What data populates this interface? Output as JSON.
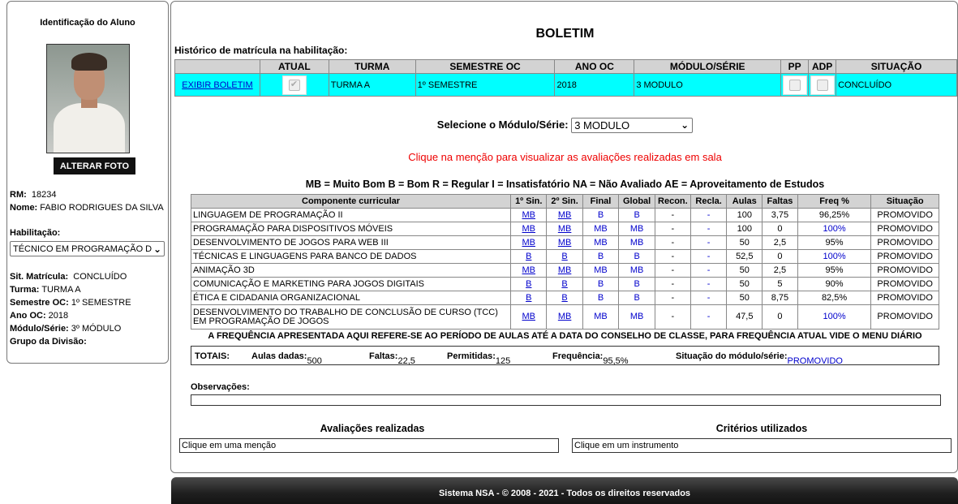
{
  "sidebar": {
    "title": "Identificação do Aluno",
    "photo_button": "ALTERAR FOTO",
    "rm_label": "RM:",
    "rm_value": "18234",
    "nome_label": "Nome:",
    "nome_value": "FABIO RODRIGUES DA SILVA",
    "habilitacao_label": "Habilitação:",
    "habilitacao_value": "TÉCNICO EM PROGRAMAÇÃO D",
    "sit_matricula_label": "Sit. Matrícula:",
    "sit_matricula_value": "CONCLUÍDO",
    "turma_label": "Turma:",
    "turma_value": "TURMA A",
    "semestre_label": "Semestre OC:",
    "semestre_value": "1º SEMESTRE",
    "ano_label": "Ano OC:",
    "ano_value": "2018",
    "modulo_label": "Módulo/Série:",
    "modulo_value": "3º MÓDULO",
    "grupo_label": "Grupo da Divisão:",
    "grupo_value": ""
  },
  "main": {
    "title": "BOLETIM",
    "historico_label": "Histórico de matrícula na habilitação:",
    "historico_headers": [
      "",
      "ATUAL",
      "TURMA",
      "SEMESTRE OC",
      "ANO OC",
      "MÓDULO/SÉRIE",
      "PP",
      "ADP",
      "SITUAÇÃO"
    ],
    "historico_row": {
      "link": "EXIBIR BOLETIM",
      "turma": "TURMA A",
      "semestre": "1º SEMESTRE",
      "ano": "2018",
      "modulo": "3 MODULO",
      "situacao": "CONCLUÍDO"
    },
    "modulo_select_label": "Selecione o Módulo/Série:",
    "modulo_select_value": "3 MODULO",
    "aviso": "Clique na menção para visualizar as avaliações realizadas em sala",
    "legenda": "MB = Muito Bom  B = Bom  R = Regular  I = Insatisfatório  NA = Não Avaliado  AE = Aproveitamento de Estudos",
    "notas_headers": [
      "Componente curricular",
      "1º Sin.",
      "2º Sin.",
      "Final",
      "Global",
      "Recon.",
      "Recla.",
      "Aulas",
      "Faltas",
      "Freq %",
      "Situação"
    ],
    "notas_rows": [
      {
        "comp": "LINGUAGEM DE PROGRAMAÇÃO II",
        "s1": "MB",
        "s2": "MB",
        "final": "B",
        "global": "B",
        "recon": "-",
        "recla": "-",
        "aulas": "100",
        "faltas": "3,75",
        "freq": "96,25%",
        "sit": "PROMOVIDO"
      },
      {
        "comp": "PROGRAMAÇÃO PARA DISPOSITIVOS MÓVEIS",
        "s1": "MB",
        "s2": "MB",
        "final": "MB",
        "global": "MB",
        "recon": "-",
        "recla": "-",
        "aulas": "100",
        "faltas": "0",
        "freq": "100%",
        "sit": "PROMOVIDO"
      },
      {
        "comp": "DESENVOLVIMENTO DE JOGOS PARA WEB III",
        "s1": "MB",
        "s2": "MB",
        "final": "MB",
        "global": "MB",
        "recon": "-",
        "recla": "-",
        "aulas": "50",
        "faltas": "2,5",
        "freq": "95%",
        "sit": "PROMOVIDO"
      },
      {
        "comp": "TÉCNICAS E LINGUAGENS PARA BANCO DE DADOS",
        "s1": "B",
        "s2": "B",
        "final": "B",
        "global": "B",
        "recon": "-",
        "recla": "-",
        "aulas": "52,5",
        "faltas": "0",
        "freq": "100%",
        "sit": "PROMOVIDO"
      },
      {
        "comp": "ANIMAÇÃO 3D",
        "s1": "MB",
        "s2": "MB",
        "final": "MB",
        "global": "MB",
        "recon": "-",
        "recla": "-",
        "aulas": "50",
        "faltas": "2,5",
        "freq": "95%",
        "sit": "PROMOVIDO"
      },
      {
        "comp": "COMUNICAÇÃO E MARKETING PARA JOGOS DIGITAIS",
        "s1": "B",
        "s2": "B",
        "final": "B",
        "global": "B",
        "recon": "-",
        "recla": "-",
        "aulas": "50",
        "faltas": "5",
        "freq": "90%",
        "sit": "PROMOVIDO"
      },
      {
        "comp": "ÉTICA E CIDADANIA ORGANIZACIONAL",
        "s1": "B",
        "s2": "B",
        "final": "B",
        "global": "B",
        "recon": "-",
        "recla": "-",
        "aulas": "50",
        "faltas": "8,75",
        "freq": "82,5%",
        "sit": "PROMOVIDO"
      },
      {
        "comp": "DESENVOLVIMENTO DO TRABALHO DE CONCLUSÃO DE CURSO (TCC) EM PROGRAMAÇÃO DE JOGOS",
        "s1": "MB",
        "s2": "MB",
        "final": "MB",
        "global": "MB",
        "recon": "-",
        "recla": "-",
        "aulas": "47,5",
        "faltas": "0",
        "freq": "100%",
        "sit": "PROMOVIDO"
      }
    ],
    "freq_note": "A FREQUÊNCIA APRESENTADA AQUI REFERE-SE AO PERÍODO DE AULAS ATÉ A DATA DO CONSELHO DE CLASSE, PARA FREQUÊNCIA ATUAL VIDE O MENU DIÁRIO",
    "totais": {
      "label": "TOTAIS:",
      "aulas_label": "Aulas dadas:",
      "aulas_value": "500",
      "faltas_label": "Faltas:",
      "faltas_value": "22,5",
      "permitidas_label": "Permitidas:",
      "permitidas_value": "125",
      "frequencia_label": "Frequência:",
      "frequencia_value": "95,5%",
      "situacao_label": "Situação do módulo/série:",
      "situacao_value": "PROMOVIDO"
    },
    "observacoes_label": "Observações:",
    "avaliacoes_title": "Avaliações realizadas",
    "avaliacoes_hint": "Clique em uma menção",
    "criterios_title": "Critérios utilizados",
    "criterios_hint": "Clique em um instrumento"
  },
  "footer": "Sistema NSA  -  © 2008 - 2021  -  Todos os direitos reservados",
  "colors": {
    "row_highlight": "#00ffff",
    "header_bg": "#d3d3d3",
    "link": "#0000cc",
    "warning": "#ee0000",
    "footer_bg": "#1f1f1f"
  }
}
